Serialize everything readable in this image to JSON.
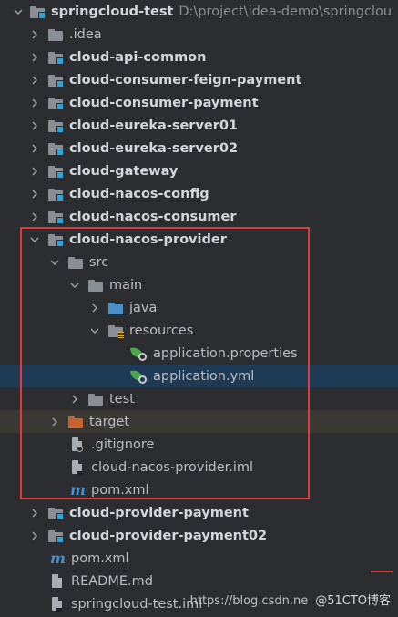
{
  "tree": {
    "root": {
      "name": "springcloud-test",
      "path": "D:\\project\\idea-demo\\springclou"
    },
    "modules": [
      ".idea",
      "cloud-api-common",
      "cloud-consumer-feign-payment",
      "cloud-consumer-payment",
      "cloud-eureka-server01",
      "cloud-eureka-server02",
      "cloud-gateway",
      "cloud-nacos-config",
      "cloud-nacos-consumer"
    ],
    "provider": {
      "name": "cloud-nacos-provider",
      "src": "src",
      "main": "main",
      "java": "java",
      "resources": "resources",
      "files": [
        "application.properties",
        "application.yml"
      ],
      "test": "test",
      "target": "target",
      "gitignore": ".gitignore",
      "iml": "cloud-nacos-provider.iml",
      "pom": "pom.xml"
    },
    "after_modules": [
      "cloud-provider-payment",
      "cloud-provider-payment02"
    ],
    "root_files": [
      "pom.xml",
      "README.md",
      "springcloud-test.iml"
    ]
  },
  "watermark": {
    "url": "https://blog.csdn.ne",
    "brand": "@51CTO博客"
  },
  "colors": {
    "highlight_box": "#e03a3a",
    "selection": "#1e3a55",
    "folder_blue": "#4a90c9",
    "excluded_orange": "#c8622f"
  }
}
